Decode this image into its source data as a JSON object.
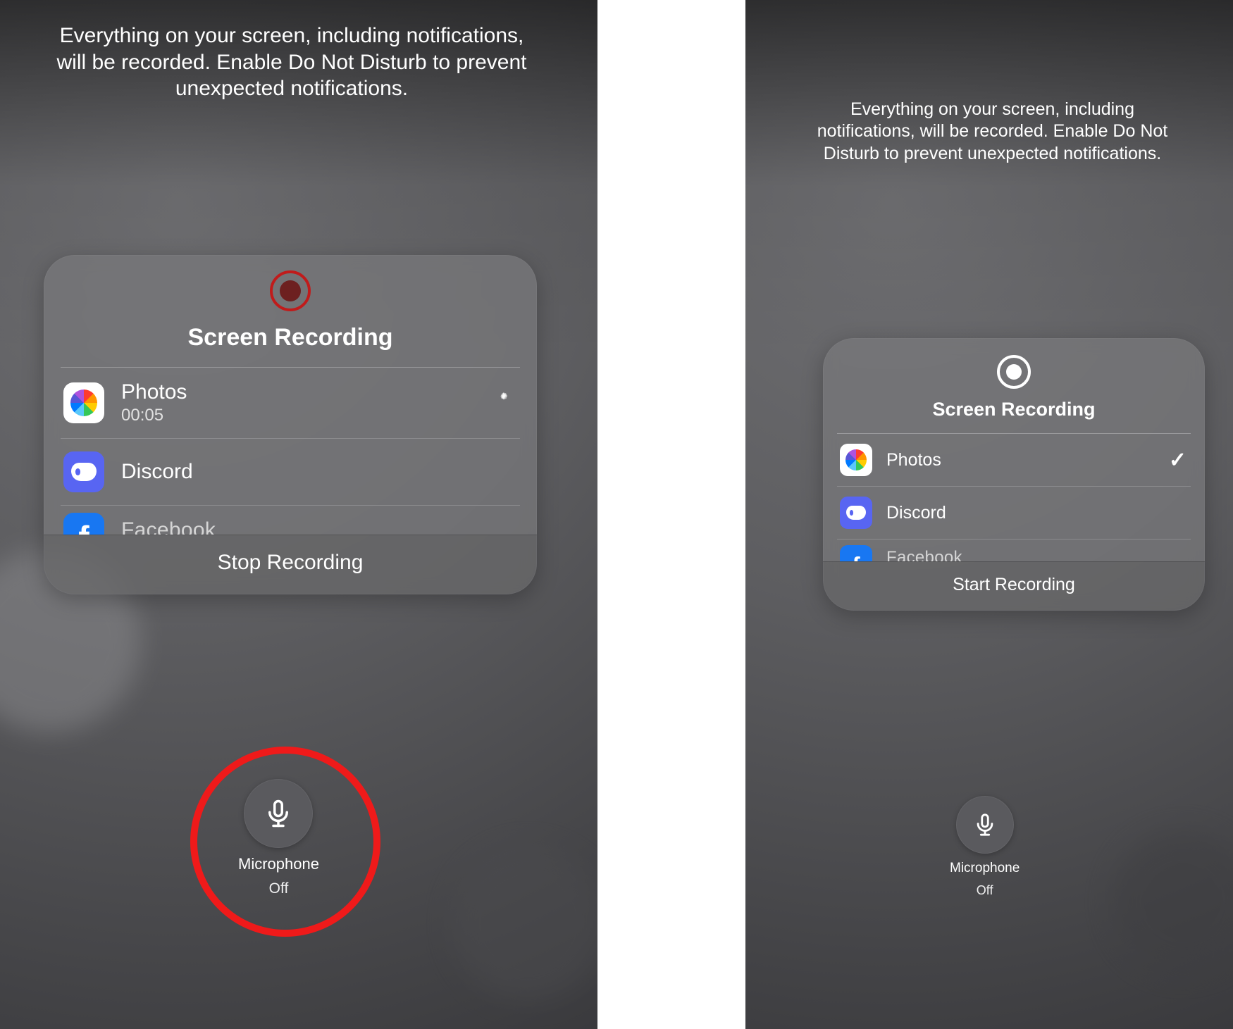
{
  "instruction_text": "Everything on your screen, including notifications, will be recorded. Enable Do Not Disturb to prevent unexpected notifications.",
  "card_title": "Screen Recording",
  "left": {
    "recording_active": true,
    "apps": [
      {
        "name": "Photos",
        "sub": "00:05",
        "status": "loading"
      },
      {
        "name": "Discord",
        "sub": "",
        "status": ""
      }
    ],
    "cutoff_app": "Facebook",
    "footer": "Stop Recording"
  },
  "right": {
    "recording_active": false,
    "apps": [
      {
        "name": "Photos",
        "sub": "",
        "status": "checked"
      },
      {
        "name": "Discord",
        "sub": "",
        "status": ""
      }
    ],
    "cutoff_app": "Facebook",
    "footer": "Start Recording"
  },
  "mic": {
    "label": "Microphone",
    "state": "Off"
  },
  "annotation": {
    "left_mic_circled": true
  }
}
